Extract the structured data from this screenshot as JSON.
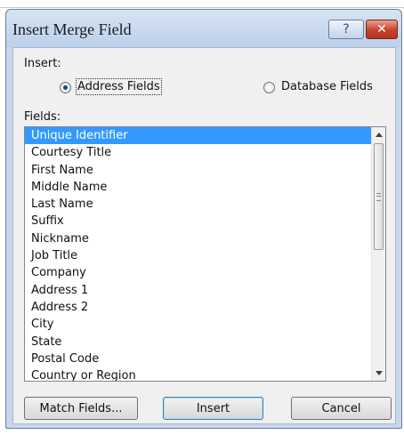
{
  "dialog": {
    "title": "Insert Merge Field",
    "help_glyph": "?",
    "close_glyph": "✕"
  },
  "insert_group": {
    "label": "Insert:",
    "options": [
      {
        "label": "Address Fields",
        "selected": true
      },
      {
        "label": "Database Fields",
        "selected": false
      }
    ]
  },
  "fields": {
    "label": "Fields:",
    "items": [
      "Unique Identifier",
      "Courtesy Title",
      "First Name",
      "Middle Name",
      "Last Name",
      "Suffix",
      "Nickname",
      "Job Title",
      "Company",
      "Address 1",
      "Address 2",
      "City",
      "State",
      "Postal Code",
      "Country or Region"
    ],
    "selected_index": 0
  },
  "buttons": {
    "match_fields": "Match Fields...",
    "insert": "Insert",
    "cancel": "Cancel"
  },
  "colors": {
    "selection": "#3399ff",
    "title_bar": "#c6d6ec",
    "close_button": "#c7422b"
  },
  "icons": {
    "help": "question-mark-icon",
    "close": "close-icon",
    "scroll_up": "arrow-up-icon",
    "scroll_down": "arrow-down-icon"
  }
}
